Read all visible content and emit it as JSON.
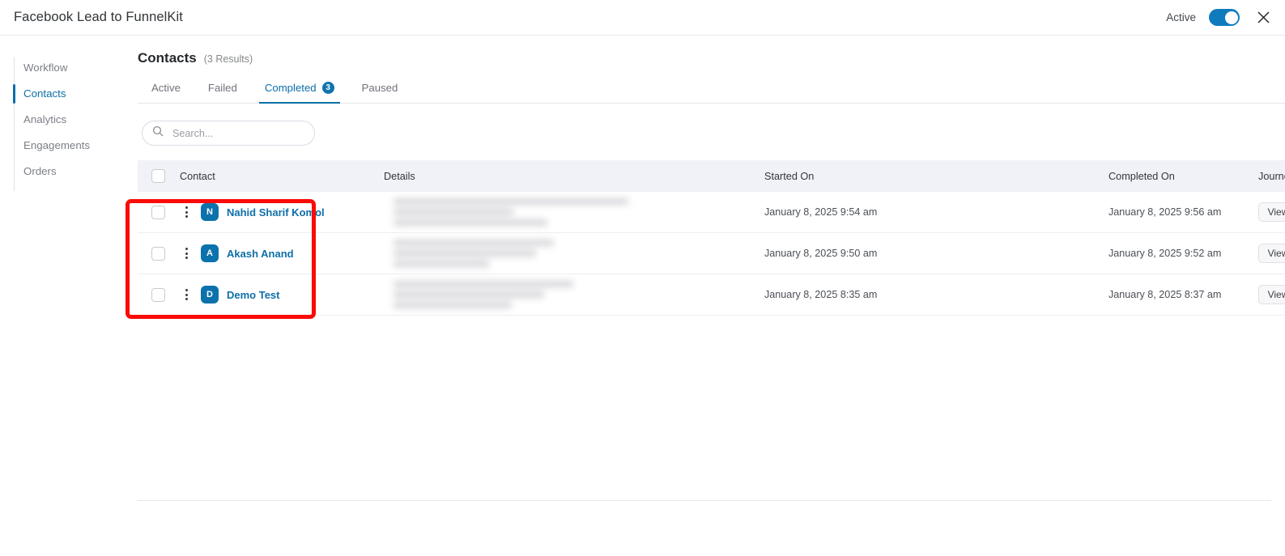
{
  "topbar": {
    "title": "Facebook Lead to FunnelKit",
    "status_label": "Active",
    "toggle_state": "on",
    "close_icon": "close-icon",
    "accent_color": "#0f7bbd"
  },
  "sidebar": {
    "items": [
      {
        "label": "Workflow",
        "active": false
      },
      {
        "label": "Contacts",
        "active": true
      },
      {
        "label": "Analytics",
        "active": false
      },
      {
        "label": "Engagements",
        "active": false
      },
      {
        "label": "Orders",
        "active": false
      }
    ]
  },
  "main": {
    "page_title": "Contacts",
    "result_count": "(3 Results)",
    "tabs": [
      {
        "label": "Active",
        "badge": "",
        "active": false
      },
      {
        "label": "Failed",
        "badge": "",
        "active": false
      },
      {
        "label": "Completed",
        "badge": "3",
        "active": true
      },
      {
        "label": "Paused",
        "badge": "",
        "active": false
      }
    ],
    "search": {
      "placeholder": "Search...",
      "value": "",
      "icon": "search-icon"
    },
    "table": {
      "columns": [
        "Contact",
        "Details",
        "Started On",
        "Completed On",
        "Journey"
      ],
      "rows": [
        {
          "initial": "N",
          "name": "Nahid Sharif Komol",
          "details": "",
          "started_on": "January 8, 2025 9:54 am",
          "completed_on": "January 8, 2025 9:56 am",
          "journey_action": "View"
        },
        {
          "initial": "A",
          "name": "Akash Anand",
          "details": "",
          "started_on": "January 8, 2025 9:50 am",
          "completed_on": "January 8, 2025 9:52 am",
          "journey_action": "View"
        },
        {
          "initial": "D",
          "name": "Demo Test",
          "details": "",
          "started_on": "January 8, 2025 8:35 am",
          "completed_on": "January 8, 2025 8:37 am",
          "journey_action": "View"
        }
      ]
    }
  },
  "annotation": {
    "color": "#fb0b07",
    "target": "contacts-column"
  }
}
